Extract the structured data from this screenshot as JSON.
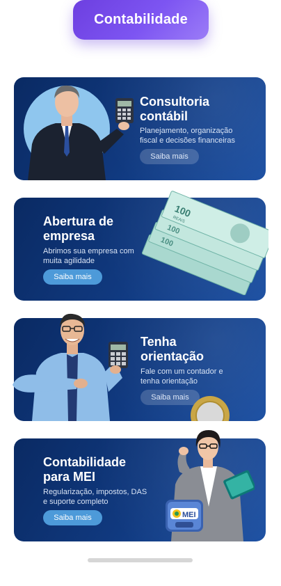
{
  "header": {
    "title": "Contabilidade"
  },
  "cards": [
    {
      "title_line1": "Consultoria",
      "title_line2": "contábil",
      "desc_line1": "Planejamento, organização",
      "desc_line2": "fiscal e decisões financeiras",
      "button": "Saiba mais"
    },
    {
      "title_line1": "Abertura de",
      "title_line2": "empresa",
      "desc_line1": "Abrimos sua empresa com",
      "desc_line2": "muita agilidade",
      "button": "Saiba mais"
    },
    {
      "title_line1": "Tenha",
      "title_line2": "orientação",
      "desc_line1": "Fale com um contador e",
      "desc_line2": "tenha orientação",
      "button": "Saiba mais"
    },
    {
      "title_line1": "Contabilidade",
      "title_line2": "para MEI",
      "desc_line1": "Regularização, impostos, DAS",
      "desc_line2": "e suporte completo",
      "button": "Saiba mais"
    }
  ],
  "money_label": "100",
  "money_sublabel": "REAIS",
  "mei_badge": "MEI",
  "colors": {
    "accent_purple": "#7d55f2",
    "card_navy": "#10397f",
    "button_blue": "#4d9ad9"
  }
}
